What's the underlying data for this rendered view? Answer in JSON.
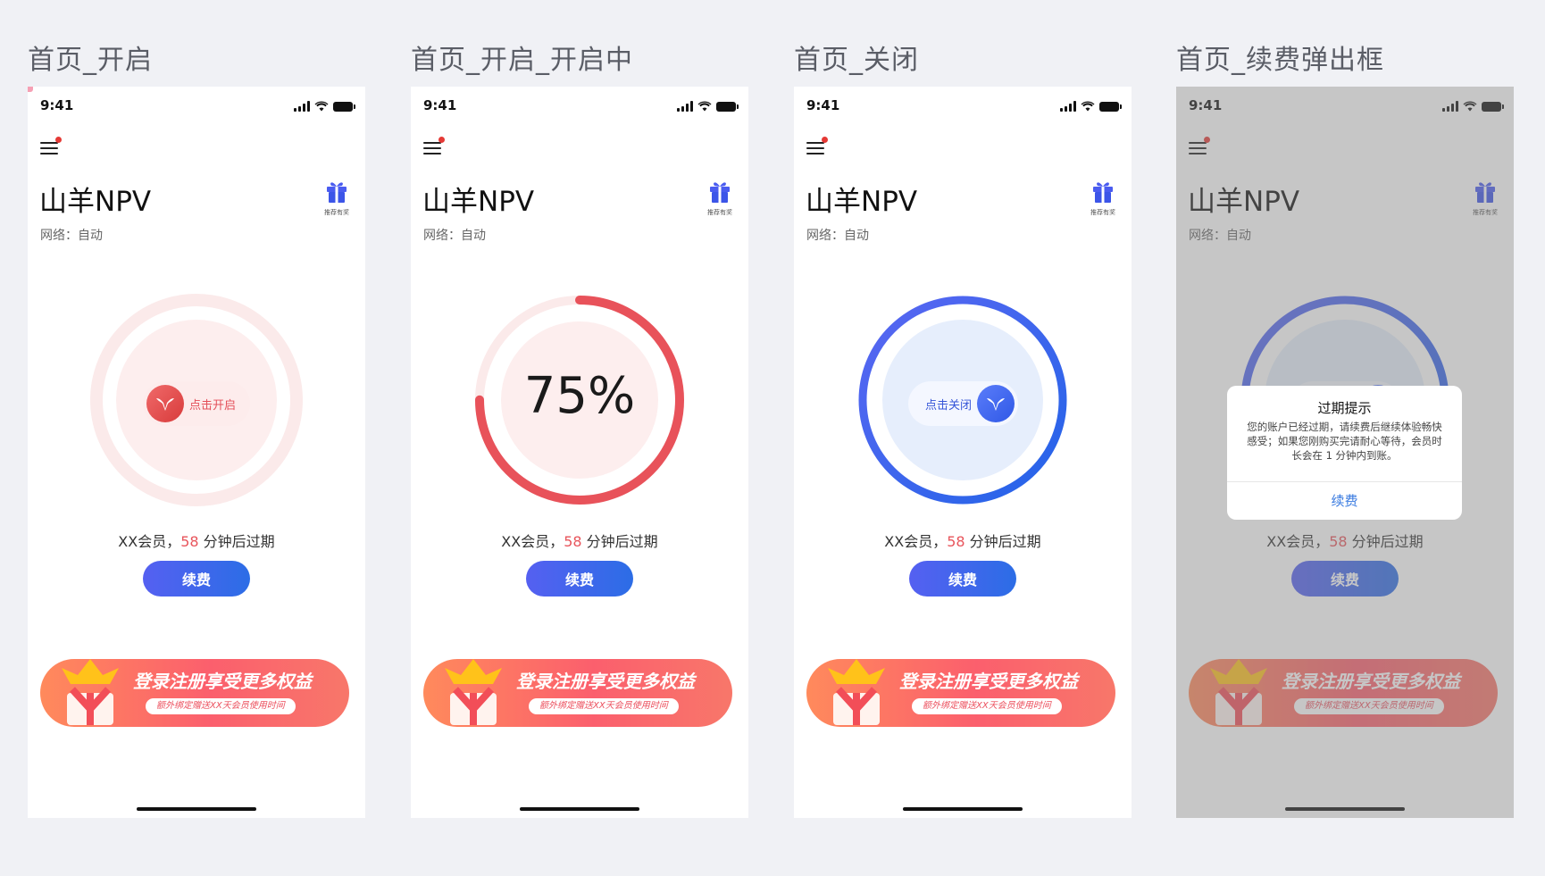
{
  "screens": [
    {
      "label": "首页_开启",
      "status": {
        "time": "9:41"
      },
      "app_title": "山羊NPV",
      "network": "网络：自动",
      "gift_caption": "推荐有奖",
      "toggle_label": "点击开启",
      "expire": {
        "prefix": "XX会员，",
        "minutes": "58",
        "suffix": " 分钟后过期"
      },
      "renew_label": "续费",
      "banner": {
        "title": "登录注册享受更多权益",
        "subtitle": "额外绑定赠送XX天会员使用时间"
      }
    },
    {
      "label": "首页_开启_开启中",
      "status": {
        "time": "9:41"
      },
      "app_title": "山羊NPV",
      "network": "网络：自动",
      "gift_caption": "推荐有奖",
      "progress_text": "75%",
      "progress": 0.75,
      "expire": {
        "prefix": "XX会员，",
        "minutes": "58",
        "suffix": " 分钟后过期"
      },
      "renew_label": "续费",
      "banner": {
        "title": "登录注册享受更多权益",
        "subtitle": "额外绑定赠送XX天会员使用时间"
      }
    },
    {
      "label": "首页_关闭",
      "status": {
        "time": "9:41"
      },
      "app_title": "山羊NPV",
      "network": "网络：自动",
      "gift_caption": "推荐有奖",
      "toggle_label": "点击关闭",
      "expire": {
        "prefix": "XX会员，",
        "minutes": "58",
        "suffix": " 分钟后过期"
      },
      "renew_label": "续费",
      "banner": {
        "title": "登录注册享受更多权益",
        "subtitle": "额外绑定赠送XX天会员使用时间"
      }
    },
    {
      "label": "首页_续费弹出框",
      "status": {
        "time": "9:41"
      },
      "app_title": "山羊NPV",
      "network": "网络：自动",
      "gift_caption": "推荐有奖",
      "expire": {
        "prefix": "XX会员，",
        "minutes": "58",
        "suffix": " 分钟后过期"
      },
      "renew_label": "续费",
      "banner": {
        "title": "登录注册享受更多权益",
        "subtitle": "额外绑定赠送XX天会员使用时间"
      },
      "dialog": {
        "title": "过期提示",
        "body": "您的账户已经过期，请续费后继续体验畅快感受；如果您刚购买完请耐心等待，会员时长会在 1 分钟内到账。",
        "button": "续费"
      }
    }
  ],
  "colors": {
    "accent_red": "#e8555c",
    "accent_blue": "#3a63ea",
    "background": "#f0f1f5"
  }
}
